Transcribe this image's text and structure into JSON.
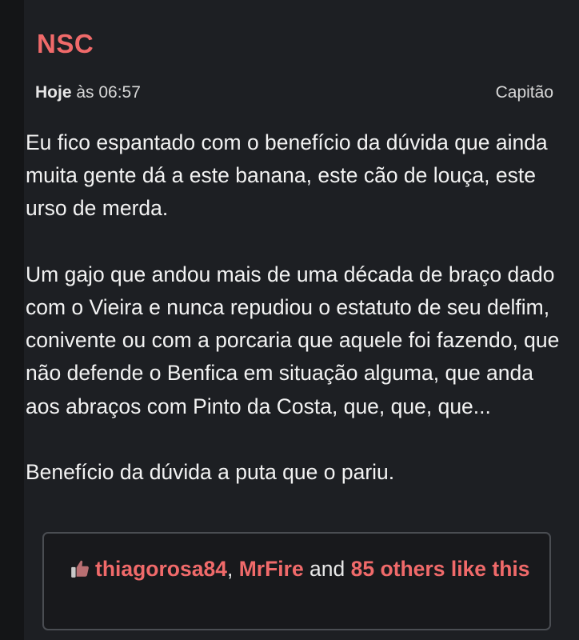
{
  "post": {
    "author": "NSC",
    "date_day": "Hoje",
    "date_rest": " às 06:57",
    "rank": "Capitão",
    "paragraphs": [
      "Eu fico espantado com o benefício da dúvida que ainda muita gente dá a este banana, este cão de louça, este urso de merda.",
      "Um gajo que andou mais de uma década de braço dado com o Vieira e nunca repudiou o estatuto de seu delfim, conivente ou com a porcaria que aquele foi fazendo, que não defende o Benfica em situação alguma, que anda aos abraços com Pinto da Costa, que, que, que...",
      "Benefício da dúvida a puta que o pariu."
    ]
  },
  "likes": {
    "icon": "thumbs-up-icon",
    "user1": "thiagorosa84",
    "separator": ", ",
    "user2": "MrFire",
    "and_text": " and ",
    "others": "85 others like this"
  },
  "colors": {
    "accent": "#f06a6a",
    "background": "#1d1f23",
    "text": "#f2f2f2"
  }
}
